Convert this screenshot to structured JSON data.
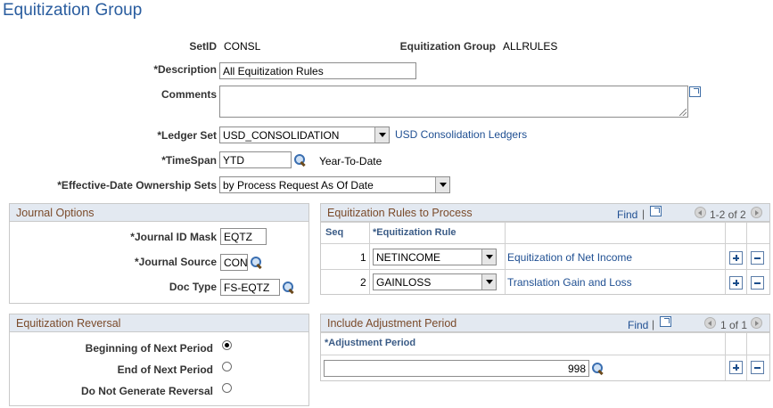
{
  "page": {
    "title": "Equitization Group"
  },
  "header": {
    "setid_label": "SetID",
    "setid_value": "CONSL",
    "group_label": "Equitization Group",
    "group_value": "ALLRULES",
    "description_label": "*Description",
    "description_value": "All Equitization Rules",
    "comments_label": "Comments",
    "comments_value": "",
    "ledger_set_label": "*Ledger Set",
    "ledger_set_value": "USD_CONSOLIDATION",
    "ledger_set_link": "USD Consolidation Ledgers",
    "timespan_label": "*TimeSpan",
    "timespan_value": "YTD",
    "timespan_desc": "Year-To-Date",
    "eff_date_label": "*Effective-Date Ownership Sets",
    "eff_date_value": "by Process Request As Of Date"
  },
  "journal_options": {
    "title": "Journal Options",
    "id_mask_label": "*Journal ID Mask",
    "id_mask_value": "EQTZ",
    "source_label": "*Journal Source",
    "source_value": "CON",
    "doc_type_label": "Doc Type",
    "doc_type_value": "FS-EQTZ"
  },
  "rules": {
    "title": "Equitization Rules to Process",
    "find_label": "Find",
    "sep": "|",
    "count": "1-2 of 2",
    "col_seq": "Seq",
    "col_rule": "*Equitization Rule",
    "rows": [
      {
        "seq": "1",
        "rule": "NETINCOME",
        "desc": "Equitization of Net Income"
      },
      {
        "seq": "2",
        "rule": "GAINLOSS",
        "desc": "Translation Gain and Loss"
      }
    ]
  },
  "reversal": {
    "title": "Equitization Reversal",
    "options": [
      {
        "label": "Beginning of Next Period",
        "selected": true
      },
      {
        "label": "End of Next Period",
        "selected": false
      },
      {
        "label": "Do Not Generate Reversal",
        "selected": false
      }
    ]
  },
  "adjustment": {
    "title": "Include Adjustment Period",
    "find_label": "Find",
    "sep": "|",
    "count": "1 of 1",
    "col_period": "*Adjustment Period",
    "period_value": "998"
  }
}
